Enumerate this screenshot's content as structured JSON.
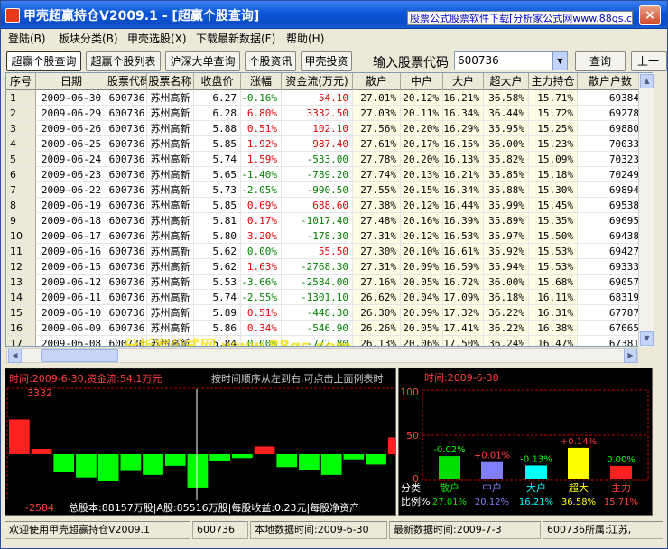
{
  "window": {
    "title": "甲壳超赢持仓V2009.1 - [超赢个股查询]",
    "ad_text": "股票公式股票软件下载[分析家公式网www.88gs.com]",
    "close_symbol": "×"
  },
  "menu": [
    {
      "label": "登陆(B)"
    },
    {
      "label": "板块分类(B)"
    },
    {
      "label": "甲壳选股(X)"
    },
    {
      "label": "下载最新数据(F)"
    },
    {
      "label": "帮助(H)"
    }
  ],
  "toolbar": {
    "buttons": [
      "超赢个股查询",
      "超赢个股列表",
      "沪深大单查询",
      "个股资讯",
      "甲壳投资"
    ],
    "code_label": "输入股票代码",
    "code_value": "600736",
    "query_label": "查询",
    "next_label": "上一"
  },
  "table": {
    "headers": [
      "序号",
      "日期",
      "股票代码",
      "股票名称",
      "收盘价",
      "涨幅",
      "资金流(万元)",
      "散户",
      "中户",
      "大户",
      "超大户",
      "主力持仓",
      "散户户数"
    ],
    "rows": [
      [
        "1",
        "2009-06-30",
        "600736",
        "苏州高新",
        "6.27",
        "-0.16%",
        "54.10",
        "27.01%",
        "20.12%",
        "16.21%",
        "36.58%",
        "15.71%",
        "69384"
      ],
      [
        "2",
        "2009-06-29",
        "600736",
        "苏州高新",
        "6.28",
        "6.80%",
        "3332.50",
        "27.03%",
        "20.11%",
        "16.34%",
        "36.44%",
        "15.72%",
        "69278"
      ],
      [
        "3",
        "2009-06-26",
        "600736",
        "苏州高新",
        "5.88",
        "0.51%",
        "102.10",
        "27.56%",
        "20.20%",
        "16.29%",
        "35.95%",
        "15.25%",
        "69880"
      ],
      [
        "4",
        "2009-06-25",
        "600736",
        "苏州高新",
        "5.85",
        "1.92%",
        "987.40",
        "27.61%",
        "20.17%",
        "16.15%",
        "36.00%",
        "15.23%",
        "70033"
      ],
      [
        "5",
        "2009-06-24",
        "600736",
        "苏州高新",
        "5.74",
        "1.59%",
        "-533.00",
        "27.78%",
        "20.20%",
        "16.13%",
        "35.82%",
        "15.09%",
        "70323"
      ],
      [
        "6",
        "2009-06-23",
        "600736",
        "苏州高新",
        "5.65",
        "-1.40%",
        "-789.20",
        "27.74%",
        "20.13%",
        "16.21%",
        "35.85%",
        "15.18%",
        "70249"
      ],
      [
        "7",
        "2009-06-22",
        "600736",
        "苏州高新",
        "5.73",
        "-2.05%",
        "-990.50",
        "27.55%",
        "20.15%",
        "16.34%",
        "35.88%",
        "15.30%",
        "69894"
      ],
      [
        "8",
        "2009-06-19",
        "600736",
        "苏州高新",
        "5.85",
        "0.69%",
        "688.60",
        "27.38%",
        "20.12%",
        "16.44%",
        "35.99%",
        "15.45%",
        "69538"
      ],
      [
        "9",
        "2009-06-18",
        "600736",
        "苏州高新",
        "5.81",
        "0.17%",
        "-1017.40",
        "27.48%",
        "20.16%",
        "16.39%",
        "35.89%",
        "15.35%",
        "69695"
      ],
      [
        "10",
        "2009-06-17",
        "600736",
        "苏州高新",
        "5.80",
        "3.20%",
        "-178.30",
        "27.31%",
        "20.12%",
        "16.53%",
        "35.97%",
        "15.50%",
        "69438"
      ],
      [
        "11",
        "2009-06-16",
        "600736",
        "苏州高新",
        "5.62",
        "0.00%",
        "55.50",
        "27.30%",
        "20.10%",
        "16.61%",
        "35.92%",
        "15.53%",
        "69427"
      ],
      [
        "12",
        "2009-06-15",
        "600736",
        "苏州高新",
        "5.62",
        "1.63%",
        "-2768.30",
        "27.31%",
        "20.09%",
        "16.59%",
        "35.94%",
        "15.53%",
        "69333"
      ],
      [
        "13",
        "2009-06-12",
        "600736",
        "苏州高新",
        "5.53",
        "-3.66%",
        "-2584.00",
        "27.16%",
        "20.05%",
        "16.72%",
        "36.00%",
        "15.68%",
        "69057"
      ],
      [
        "14",
        "2009-06-11",
        "600736",
        "苏州高新",
        "5.74",
        "-2.55%",
        "-1301.10",
        "26.62%",
        "20.04%",
        "17.09%",
        "36.18%",
        "16.11%",
        "68319"
      ],
      [
        "15",
        "2009-06-10",
        "600736",
        "苏州高新",
        "5.89",
        "0.51%",
        "-448.30",
        "26.30%",
        "20.09%",
        "17.32%",
        "36.22%",
        "16.31%",
        "67787"
      ],
      [
        "16",
        "2009-06-09",
        "600736",
        "苏州高新",
        "5.86",
        "0.34%",
        "-546.90",
        "26.26%",
        "20.05%",
        "17.41%",
        "36.22%",
        "16.38%",
        "67665"
      ],
      [
        "17",
        "2009-06-08",
        "600736",
        "苏州高新",
        "5.84",
        "0.00%",
        "-772.80",
        "26.13%",
        "20.06%",
        "17.50%",
        "36.24%",
        "16.47%",
        "67381"
      ]
    ]
  },
  "watermark": "分析家公式网 www.88gs.com",
  "left_panel": {
    "header": "时间:2009-6-30,资金流:54.1万元",
    "hint": "按时间顺序从左到右,可点击上面例表时",
    "ymax": "3332",
    "ymin": "-2584",
    "info": "总股本:88157万股|A股:85516万股|每股收益:0.23元|每股净资产"
  },
  "chart_data": {
    "type": "bar",
    "title": "时间:2009-6-30",
    "categories": [
      "散户",
      "中户",
      "大户",
      "超大",
      "主力"
    ],
    "values": [
      27.01,
      20.12,
      16.21,
      36.58,
      15.71
    ],
    "changes": [
      "-0.02%",
      "+0.01%",
      "-0.13%",
      "+0.14%",
      "0.00%"
    ],
    "colors": [
      "#00e000",
      "#8080ff",
      "#00ffff",
      "#ffff00",
      "#ff2020"
    ],
    "ylim": [
      0,
      100
    ],
    "yticks": [
      "100",
      "50",
      "0"
    ],
    "row_labels": [
      "分类",
      "比例%"
    ]
  },
  "status": {
    "welcome": "欢迎使用甲壳超赢持仓V2009.1",
    "code": "600736",
    "local_time": "本地数据时间:2009-6-30",
    "latest_time": "最新数据时间:2009-7-3",
    "belong": "600736所属:江苏,"
  }
}
